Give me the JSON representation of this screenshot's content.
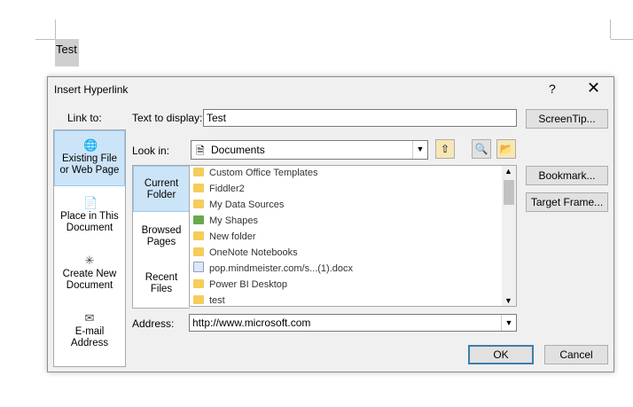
{
  "document": {
    "text": "Test"
  },
  "dialog": {
    "title": "Insert Hyperlink",
    "help": "?",
    "close": "✕",
    "link_to_label": "Link to:",
    "link_items": [
      {
        "line1": "Existing File",
        "line2": "or Web Page"
      },
      {
        "line1": "Place in This",
        "line2": "Document"
      },
      {
        "line1": "Create New",
        "line2": "Document"
      },
      {
        "line1": "E-mail",
        "line2": "Address"
      }
    ],
    "text_to_display_label": "Text to display:",
    "text_to_display_value": "Test",
    "screentip_button": "ScreenTip...",
    "look_in_label": "Look in:",
    "look_in_value": "Documents",
    "side_items": [
      {
        "line1": "Current",
        "line2": "Folder"
      },
      {
        "line1": "Browsed",
        "line2": "Pages"
      },
      {
        "line1": "Recent",
        "line2": "Files"
      }
    ],
    "files": [
      "Custom Office Templates",
      "Fiddler2",
      "My Data Sources",
      "My Shapes",
      "New folder",
      "OneNote Notebooks",
      "pop.mindmeister.com/s...(1).docx",
      "Power BI Desktop",
      "test"
    ],
    "bookmark_button": "Bookmark...",
    "target_frame_button": "Target Frame...",
    "address_label": "Address:",
    "address_value": "http://www.microsoft.com",
    "ok_button": "OK",
    "cancel_button": "Cancel"
  }
}
